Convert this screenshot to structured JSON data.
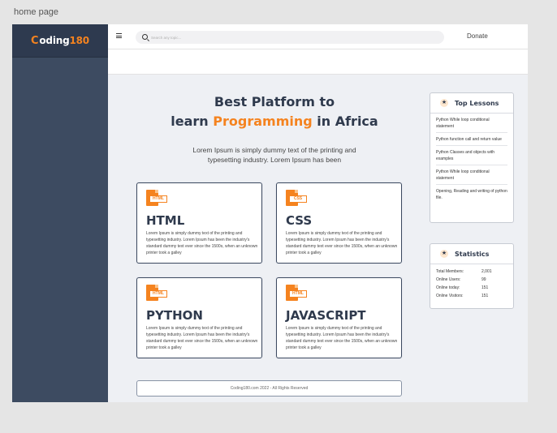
{
  "canvas": {
    "label": "home page"
  },
  "logo": {
    "c": "C",
    "text": "oding",
    "num": "180"
  },
  "topbar": {
    "search_placeholder": "Search any topic...",
    "donate": "Donate"
  },
  "hero": {
    "line1": "Best Platform to",
    "line2_pre": "learn ",
    "line2_accent": "Programming",
    "line2_post": " in Africa",
    "desc": "Lorem Ipsum is simply dummy text of the printing and typesetting industry. Lorem Ipsum has been"
  },
  "cards": [
    {
      "title": "HTML",
      "icon_tag": "HTML",
      "icon": "html-file-icon",
      "text": "Lorem Ipsum is simply dummy text of the printing and typesetting industry. Lorem Ipsum has been the industry's standard dummy text ever since the 1500s, when an unknown printer took a galley"
    },
    {
      "title": "CSS",
      "icon_tag": "CSS",
      "icon": "css-file-icon",
      "text": "Lorem Ipsum is simply dummy text of the printing and typesetting industry. Lorem Ipsum has been the industry's standard dummy text ever since the 1500s, when an unknown printer took a galley"
    },
    {
      "title": "PYTHON",
      "icon_tag": "HTML",
      "icon": "html-file-icon",
      "text": "Lorem Ipsum is simply dummy text of the printing and typesetting industry. Lorem Ipsum has been the industry's standard dummy text ever since the 1500s, when an unknown printer took a galley"
    },
    {
      "title": "JAVASCRIPT",
      "icon_tag": "HTML",
      "icon": "html-file-icon",
      "text": "Lorem Ipsum is simply dummy text of the printing and typesetting industry. Lorem Ipsum has been the industry's standard dummy text ever since the 1500s, when an unknown printer took a galley"
    }
  ],
  "footer": {
    "text": "Coding180.com 2022 - All Rights Reserved"
  },
  "top_lessons": {
    "title": "Top Lessons",
    "items": [
      "Python While loop conditional statement",
      "Python function call and return value",
      "Python Classes and objects with examples",
      "Python While loop conditional statement",
      "Opening, Reading and writing of python file."
    ]
  },
  "statistics": {
    "title": "Statistics",
    "rows": [
      {
        "label": "Total Members:",
        "value": "2,001"
      },
      {
        "label": "Online Users:",
        "value": "99"
      },
      {
        "label": "Online today:",
        "value": "151"
      },
      {
        "label": "Online Visitors:",
        "value": "151"
      }
    ]
  },
  "colors": {
    "accent": "#f5831f",
    "sidebar": "#3d4b61",
    "heading": "#2f3a4d"
  }
}
